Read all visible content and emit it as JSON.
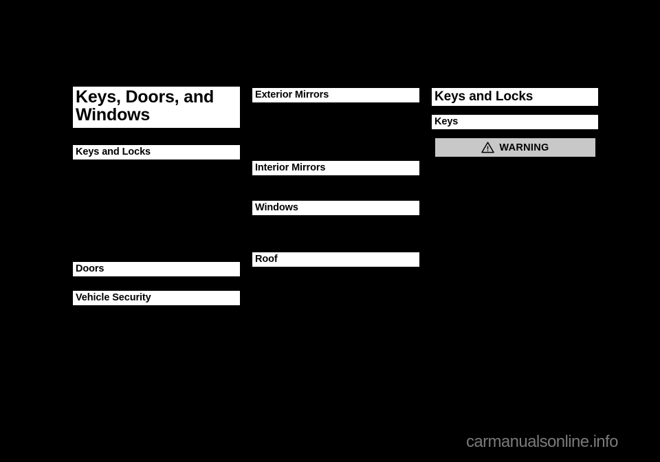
{
  "page": {
    "background_color": "#000000",
    "bar_color": "#ffffff",
    "bar_text_color": "#000000",
    "warning_box_color": "#c8c8c8",
    "watermark_color": "#7a7a7a"
  },
  "chapter": {
    "title": "Keys, Doors, and Windows"
  },
  "columns": {
    "left": {
      "headings": [
        {
          "id": "keys-and-locks",
          "label": "Keys and Locks"
        },
        {
          "id": "doors",
          "label": "Doors"
        },
        {
          "id": "vehicle-security",
          "label": "Vehicle Security"
        }
      ],
      "hidden_entries": [
        "",
        "",
        ""
      ]
    },
    "middle": {
      "headings": [
        {
          "id": "exterior-mirrors",
          "label": "Exterior Mirrors"
        },
        {
          "id": "interior-mirrors",
          "label": "Interior Mirrors"
        },
        {
          "id": "windows",
          "label": "Windows"
        },
        {
          "id": "roof",
          "label": "Roof"
        }
      ],
      "hidden_entries": [
        "",
        "",
        ""
      ],
      "clipped_entry": ""
    },
    "right": {
      "headings": [
        {
          "id": "keys-and-locks",
          "label": "Keys and Locks"
        },
        {
          "id": "keys",
          "label": "Keys"
        }
      ],
      "warning": {
        "label": "WARNING",
        "icon": "warning-triangle-icon"
      }
    }
  },
  "footer": {
    "watermark": "carmanualsonline.info"
  }
}
